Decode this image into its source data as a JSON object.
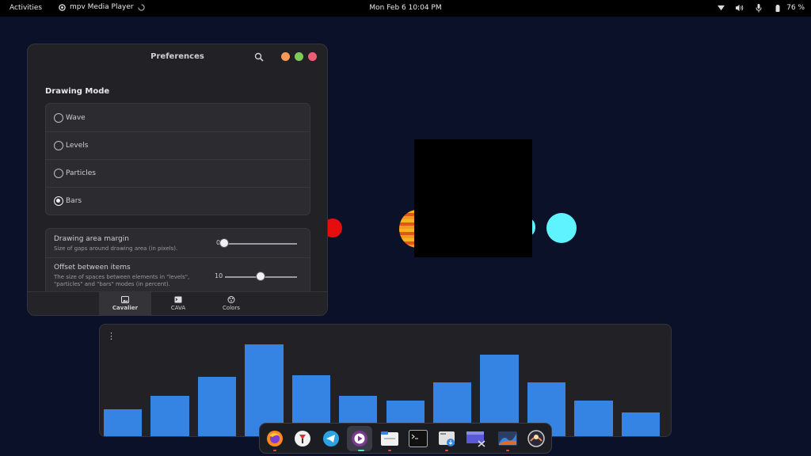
{
  "topbar": {
    "activities": "Activities",
    "app_name": "mpv Media Player",
    "clock": "Mon Feb 6  10:04 PM",
    "battery": "76 %",
    "icons": [
      "network-icon",
      "volume-icon",
      "microphone-icon",
      "battery-icon"
    ]
  },
  "prefs": {
    "title": "Preferences",
    "section_title": "Drawing Mode",
    "modes": [
      {
        "label": "Wave",
        "selected": false
      },
      {
        "label": "Levels",
        "selected": false
      },
      {
        "label": "Particles",
        "selected": false
      },
      {
        "label": "Bars",
        "selected": true
      }
    ],
    "sliders": [
      {
        "title": "Drawing area margin",
        "subtitle": "Size of gaps around drawing area (in pixels).",
        "value": "0"
      },
      {
        "title": "Offset between items",
        "subtitle": "The size of spaces between elements in \"levels\", \"particles\" and \"bars\" modes (in percent).",
        "value": "10"
      }
    ],
    "tabs": [
      {
        "label": "Cavalier",
        "icon": "image-icon",
        "active": true
      },
      {
        "label": "CAVA",
        "icon": "terminal-icon",
        "active": false
      },
      {
        "label": "Colors",
        "icon": "palette-icon",
        "active": false
      }
    ],
    "colors": {
      "minimize": "#f89a56",
      "maximize": "#7fcb5a",
      "close": "#f25b76"
    }
  },
  "visualizer": {
    "bar_color": "#3584e4",
    "levels": [
      0.29,
      0.44,
      0.65,
      1.0,
      0.66,
      0.44,
      0.39,
      0.59,
      0.89,
      0.59,
      0.39,
      0.26
    ]
  },
  "desktop": {
    "orb_colors": [
      "#e50d0d",
      "#f29a1f",
      "#5ef3ff"
    ]
  },
  "dock": {
    "apps": [
      {
        "name": "firefox-icon",
        "running": true
      },
      {
        "name": "download-manager-icon",
        "running": false
      },
      {
        "name": "telegram-icon",
        "running": false
      },
      {
        "name": "mpv-icon",
        "running": true
      },
      {
        "name": "files-icon",
        "running": true
      },
      {
        "name": "terminal-icon",
        "running": false
      },
      {
        "name": "installer-icon",
        "running": true
      },
      {
        "name": "screenshot-icon",
        "running": false
      },
      {
        "name": "cavalier-icon",
        "running": true
      },
      {
        "name": "app-icon",
        "running": false
      }
    ]
  }
}
